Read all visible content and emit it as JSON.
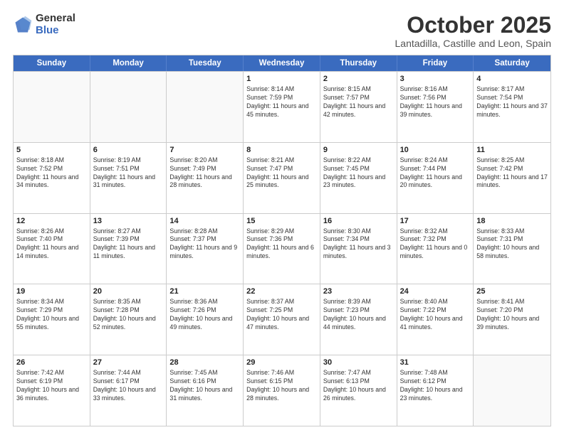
{
  "logo": {
    "general": "General",
    "blue": "Blue"
  },
  "header": {
    "month": "October 2025",
    "location": "Lantadilla, Castille and Leon, Spain"
  },
  "days": [
    "Sunday",
    "Monday",
    "Tuesday",
    "Wednesday",
    "Thursday",
    "Friday",
    "Saturday"
  ],
  "weeks": [
    [
      {
        "day": "",
        "empty": true
      },
      {
        "day": "",
        "empty": true
      },
      {
        "day": "",
        "empty": true
      },
      {
        "day": "1",
        "sunrise": "Sunrise: 8:14 AM",
        "sunset": "Sunset: 7:59 PM",
        "daylight": "Daylight: 11 hours and 45 minutes."
      },
      {
        "day": "2",
        "sunrise": "Sunrise: 8:15 AM",
        "sunset": "Sunset: 7:57 PM",
        "daylight": "Daylight: 11 hours and 42 minutes."
      },
      {
        "day": "3",
        "sunrise": "Sunrise: 8:16 AM",
        "sunset": "Sunset: 7:56 PM",
        "daylight": "Daylight: 11 hours and 39 minutes."
      },
      {
        "day": "4",
        "sunrise": "Sunrise: 8:17 AM",
        "sunset": "Sunset: 7:54 PM",
        "daylight": "Daylight: 11 hours and 37 minutes."
      }
    ],
    [
      {
        "day": "5",
        "sunrise": "Sunrise: 8:18 AM",
        "sunset": "Sunset: 7:52 PM",
        "daylight": "Daylight: 11 hours and 34 minutes."
      },
      {
        "day": "6",
        "sunrise": "Sunrise: 8:19 AM",
        "sunset": "Sunset: 7:51 PM",
        "daylight": "Daylight: 11 hours and 31 minutes."
      },
      {
        "day": "7",
        "sunrise": "Sunrise: 8:20 AM",
        "sunset": "Sunset: 7:49 PM",
        "daylight": "Daylight: 11 hours and 28 minutes."
      },
      {
        "day": "8",
        "sunrise": "Sunrise: 8:21 AM",
        "sunset": "Sunset: 7:47 PM",
        "daylight": "Daylight: 11 hours and 25 minutes."
      },
      {
        "day": "9",
        "sunrise": "Sunrise: 8:22 AM",
        "sunset": "Sunset: 7:45 PM",
        "daylight": "Daylight: 11 hours and 23 minutes."
      },
      {
        "day": "10",
        "sunrise": "Sunrise: 8:24 AM",
        "sunset": "Sunset: 7:44 PM",
        "daylight": "Daylight: 11 hours and 20 minutes."
      },
      {
        "day": "11",
        "sunrise": "Sunrise: 8:25 AM",
        "sunset": "Sunset: 7:42 PM",
        "daylight": "Daylight: 11 hours and 17 minutes."
      }
    ],
    [
      {
        "day": "12",
        "sunrise": "Sunrise: 8:26 AM",
        "sunset": "Sunset: 7:40 PM",
        "daylight": "Daylight: 11 hours and 14 minutes."
      },
      {
        "day": "13",
        "sunrise": "Sunrise: 8:27 AM",
        "sunset": "Sunset: 7:39 PM",
        "daylight": "Daylight: 11 hours and 11 minutes."
      },
      {
        "day": "14",
        "sunrise": "Sunrise: 8:28 AM",
        "sunset": "Sunset: 7:37 PM",
        "daylight": "Daylight: 11 hours and 9 minutes."
      },
      {
        "day": "15",
        "sunrise": "Sunrise: 8:29 AM",
        "sunset": "Sunset: 7:36 PM",
        "daylight": "Daylight: 11 hours and 6 minutes."
      },
      {
        "day": "16",
        "sunrise": "Sunrise: 8:30 AM",
        "sunset": "Sunset: 7:34 PM",
        "daylight": "Daylight: 11 hours and 3 minutes."
      },
      {
        "day": "17",
        "sunrise": "Sunrise: 8:32 AM",
        "sunset": "Sunset: 7:32 PM",
        "daylight": "Daylight: 11 hours and 0 minutes."
      },
      {
        "day": "18",
        "sunrise": "Sunrise: 8:33 AM",
        "sunset": "Sunset: 7:31 PM",
        "daylight": "Daylight: 10 hours and 58 minutes."
      }
    ],
    [
      {
        "day": "19",
        "sunrise": "Sunrise: 8:34 AM",
        "sunset": "Sunset: 7:29 PM",
        "daylight": "Daylight: 10 hours and 55 minutes."
      },
      {
        "day": "20",
        "sunrise": "Sunrise: 8:35 AM",
        "sunset": "Sunset: 7:28 PM",
        "daylight": "Daylight: 10 hours and 52 minutes."
      },
      {
        "day": "21",
        "sunrise": "Sunrise: 8:36 AM",
        "sunset": "Sunset: 7:26 PM",
        "daylight": "Daylight: 10 hours and 49 minutes."
      },
      {
        "day": "22",
        "sunrise": "Sunrise: 8:37 AM",
        "sunset": "Sunset: 7:25 PM",
        "daylight": "Daylight: 10 hours and 47 minutes."
      },
      {
        "day": "23",
        "sunrise": "Sunrise: 8:39 AM",
        "sunset": "Sunset: 7:23 PM",
        "daylight": "Daylight: 10 hours and 44 minutes."
      },
      {
        "day": "24",
        "sunrise": "Sunrise: 8:40 AM",
        "sunset": "Sunset: 7:22 PM",
        "daylight": "Daylight: 10 hours and 41 minutes."
      },
      {
        "day": "25",
        "sunrise": "Sunrise: 8:41 AM",
        "sunset": "Sunset: 7:20 PM",
        "daylight": "Daylight: 10 hours and 39 minutes."
      }
    ],
    [
      {
        "day": "26",
        "sunrise": "Sunrise: 7:42 AM",
        "sunset": "Sunset: 6:19 PM",
        "daylight": "Daylight: 10 hours and 36 minutes."
      },
      {
        "day": "27",
        "sunrise": "Sunrise: 7:44 AM",
        "sunset": "Sunset: 6:17 PM",
        "daylight": "Daylight: 10 hours and 33 minutes."
      },
      {
        "day": "28",
        "sunrise": "Sunrise: 7:45 AM",
        "sunset": "Sunset: 6:16 PM",
        "daylight": "Daylight: 10 hours and 31 minutes."
      },
      {
        "day": "29",
        "sunrise": "Sunrise: 7:46 AM",
        "sunset": "Sunset: 6:15 PM",
        "daylight": "Daylight: 10 hours and 28 minutes."
      },
      {
        "day": "30",
        "sunrise": "Sunrise: 7:47 AM",
        "sunset": "Sunset: 6:13 PM",
        "daylight": "Daylight: 10 hours and 26 minutes."
      },
      {
        "day": "31",
        "sunrise": "Sunrise: 7:48 AM",
        "sunset": "Sunset: 6:12 PM",
        "daylight": "Daylight: 10 hours and 23 minutes."
      },
      {
        "day": "",
        "empty": true
      }
    ]
  ]
}
